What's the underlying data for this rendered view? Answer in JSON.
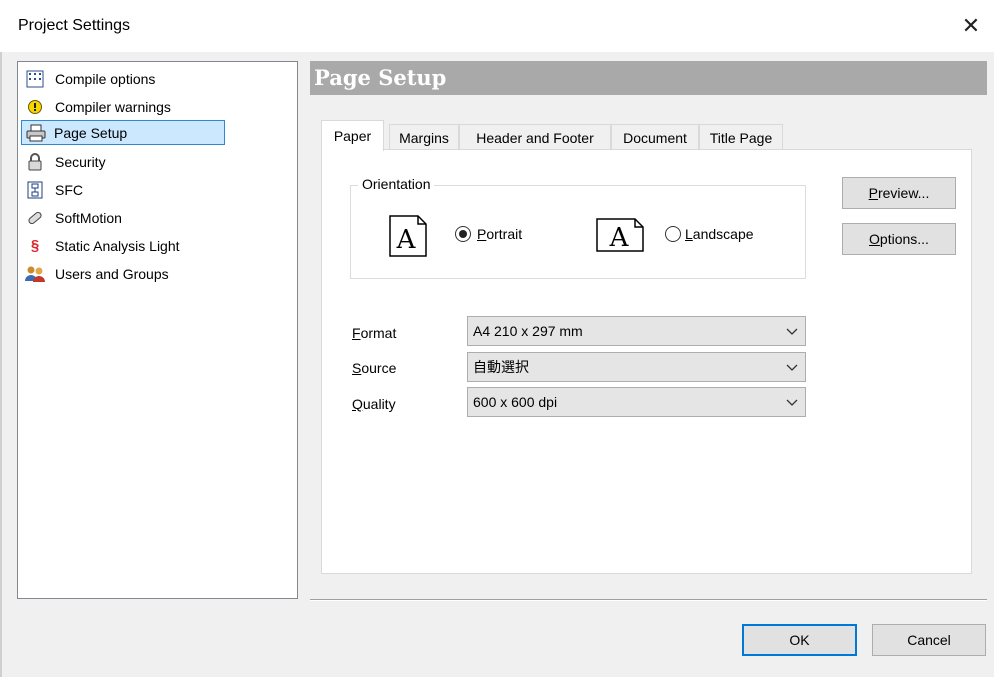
{
  "window": {
    "title": "Project Settings",
    "close_glyph": "✕"
  },
  "tree": {
    "items": [
      {
        "label": "Compile options",
        "icon": "compile-options-icon"
      },
      {
        "label": "Compiler warnings",
        "icon": "warning-icon"
      },
      {
        "label": "Page Setup",
        "icon": "printer-icon",
        "selected": true
      },
      {
        "label": "Security",
        "icon": "lock-icon"
      },
      {
        "label": "SFC",
        "icon": "sfc-icon"
      },
      {
        "label": "SoftMotion",
        "icon": "softmotion-icon"
      },
      {
        "label": "Static Analysis Light",
        "icon": "section-sign-icon"
      },
      {
        "label": "Users and Groups",
        "icon": "users-icon"
      }
    ]
  },
  "page": {
    "header": "Page Setup"
  },
  "tabs": [
    {
      "label": "Paper",
      "active": true
    },
    {
      "label": "Margins"
    },
    {
      "label": "Header and Footer"
    },
    {
      "label": "Document"
    },
    {
      "label": "Title Page"
    }
  ],
  "paper": {
    "orientation_label": "Orientation",
    "glyph_letter": "A",
    "portrait": {
      "label_first": "P",
      "label_rest": "ortrait",
      "checked": true
    },
    "landscape": {
      "label_first": "L",
      "label_rest": "andscape",
      "checked": false
    },
    "format": {
      "label_first": "F",
      "label_rest": "ormat",
      "value": "A4 210 x 297 mm"
    },
    "source": {
      "label_first": "S",
      "label_rest": "ource",
      "value": "自動選択"
    },
    "quality": {
      "label_first": "Q",
      "label_rest": "uality",
      "value": "600 x 600 dpi"
    },
    "preview_button": {
      "label_first": "P",
      "label_rest": "review..."
    },
    "options_button": {
      "label_first": "O",
      "label_rest": "ptions..."
    }
  },
  "footer": {
    "ok_label": "OK",
    "cancel_label": "Cancel"
  },
  "colors": {
    "selection_bg": "#cce8ff",
    "selection_border": "#2a8ad4",
    "header_bg": "#a9a9a9",
    "default_button_border": "#0078d7"
  }
}
